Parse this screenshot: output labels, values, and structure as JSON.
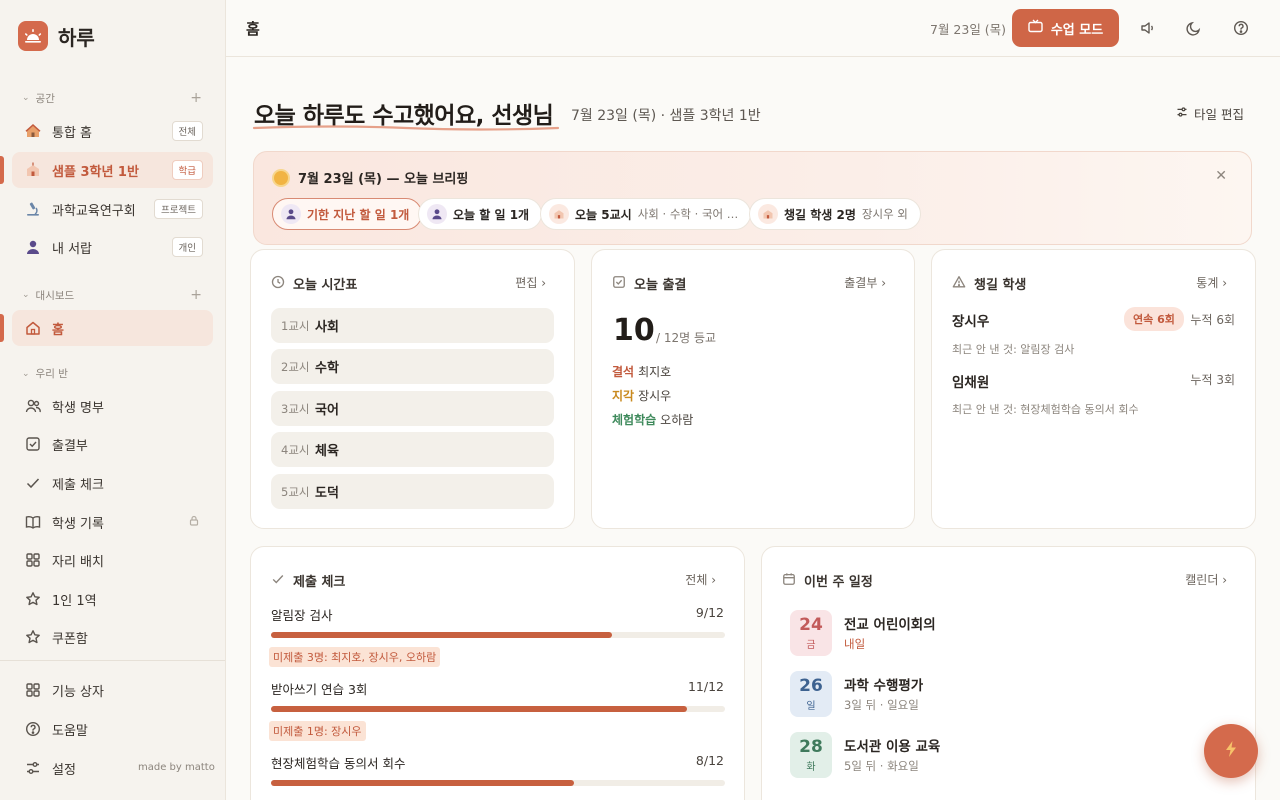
{
  "brand": {
    "name": "하루"
  },
  "sidebar": {
    "sections": {
      "space": "공간",
      "dashboard": "대시보드",
      "myclass": "우리 반"
    },
    "space_items": [
      {
        "label": "통합 홈",
        "tag": "전체"
      },
      {
        "label": "샘플 3학년 1반",
        "tag": "학급"
      },
      {
        "label": "과학교육연구회",
        "tag": "프로젝트"
      },
      {
        "label": "내 서랍",
        "tag": "개인"
      }
    ],
    "dashboard_items": [
      {
        "label": "홈"
      }
    ],
    "class_items": [
      {
        "label": "학생 명부"
      },
      {
        "label": "출결부"
      },
      {
        "label": "제출 체크"
      },
      {
        "label": "학생 기록"
      },
      {
        "label": "자리 배치"
      },
      {
        "label": "1인 1역"
      },
      {
        "label": "쿠폰함"
      }
    ],
    "bottom_items": [
      {
        "label": "기능 상자"
      },
      {
        "label": "도움말"
      },
      {
        "label": "설정"
      }
    ],
    "made_by": "made by matto"
  },
  "header": {
    "title": "홈",
    "date": "7월 23일 (목)",
    "class_mode_label": "수업 모드"
  },
  "greeting": {
    "title": "오늘 하루도 수고했어요, 선생님",
    "subtitle": "7월 23일 (목) · 샘플 3학년 1반",
    "tile_edit": "타일 편집"
  },
  "briefing": {
    "title": "7월 23일 (목) — 오늘 브리핑",
    "chips": [
      {
        "strong": "기한 지난 할 일 1개",
        "muted": ""
      },
      {
        "strong": "오늘 할 일 1개",
        "muted": ""
      },
      {
        "strong": "오늘 5교시",
        "muted": "사회 · 수학 · 국어 …"
      },
      {
        "strong": "챙길 학생 2명",
        "muted": "장시우 외"
      }
    ]
  },
  "timetable": {
    "title": "오늘 시간표",
    "link": "편집",
    "periods": [
      {
        "no": "1교시",
        "subject": "사회"
      },
      {
        "no": "2교시",
        "subject": "수학"
      },
      {
        "no": "3교시",
        "subject": "국어"
      },
      {
        "no": "4교시",
        "subject": "체육"
      },
      {
        "no": "5교시",
        "subject": "도덕"
      }
    ]
  },
  "attendance": {
    "title": "오늘 출결",
    "link": "출결부",
    "present": "10",
    "summary": "/ 12명 등교",
    "rows": [
      {
        "type": "결석",
        "name": "최지호",
        "color": "#c25a3d"
      },
      {
        "type": "지각",
        "name": "장시우",
        "color": "#c98a1f"
      },
      {
        "type": "체험학습",
        "name": "오하람",
        "color": "#3f8a5c"
      }
    ]
  },
  "care": {
    "title": "챙길 학생",
    "link": "통계",
    "students": [
      {
        "name": "장시우",
        "streak": "연속 6회",
        "total": "누적 6회",
        "note": "최근 안 낸 것: 알림장 검사"
      },
      {
        "name": "임채원",
        "streak": "",
        "total": "누적 3회",
        "note": "최근 안 낸 것: 현장체험학습 동의서 회수"
      }
    ]
  },
  "submissions": {
    "title": "제출 체크",
    "link": "전체",
    "items": [
      {
        "name": "알림장 검사",
        "count": "9/12",
        "progress": 0.75,
        "missing": "미제출 3명: 최지호, 장시우, 오하람"
      },
      {
        "name": "받아쓰기 연습 3회",
        "count": "11/12",
        "progress": 0.917,
        "missing": "미제출 1명: 장시우"
      },
      {
        "name": "현장체험학습 동의서 회수",
        "count": "8/12",
        "progress": 0.667,
        "missing": ""
      }
    ]
  },
  "schedule": {
    "title": "이번 주 일정",
    "link": "캘린더",
    "events": [
      {
        "day": "24",
        "weekday": "금",
        "title": "전교 어린이회의",
        "when": "내일",
        "bg": "#f9e4e6",
        "fg": "#c25a5a"
      },
      {
        "day": "26",
        "weekday": "일",
        "title": "과학 수행평가",
        "when": "3일 뒤 · 일요일",
        "bg": "#e3ebf5",
        "fg": "#3d6290"
      },
      {
        "day": "28",
        "weekday": "화",
        "title": "도서관 이용 교육",
        "when": "5일 뒤 · 화요일",
        "bg": "#e2efe8",
        "fg": "#3f7a5c"
      }
    ]
  },
  "colors": {
    "accent": "#cf6647",
    "sidebar_bg": "#f6f3ee",
    "page_bg": "#fbfaf7"
  }
}
